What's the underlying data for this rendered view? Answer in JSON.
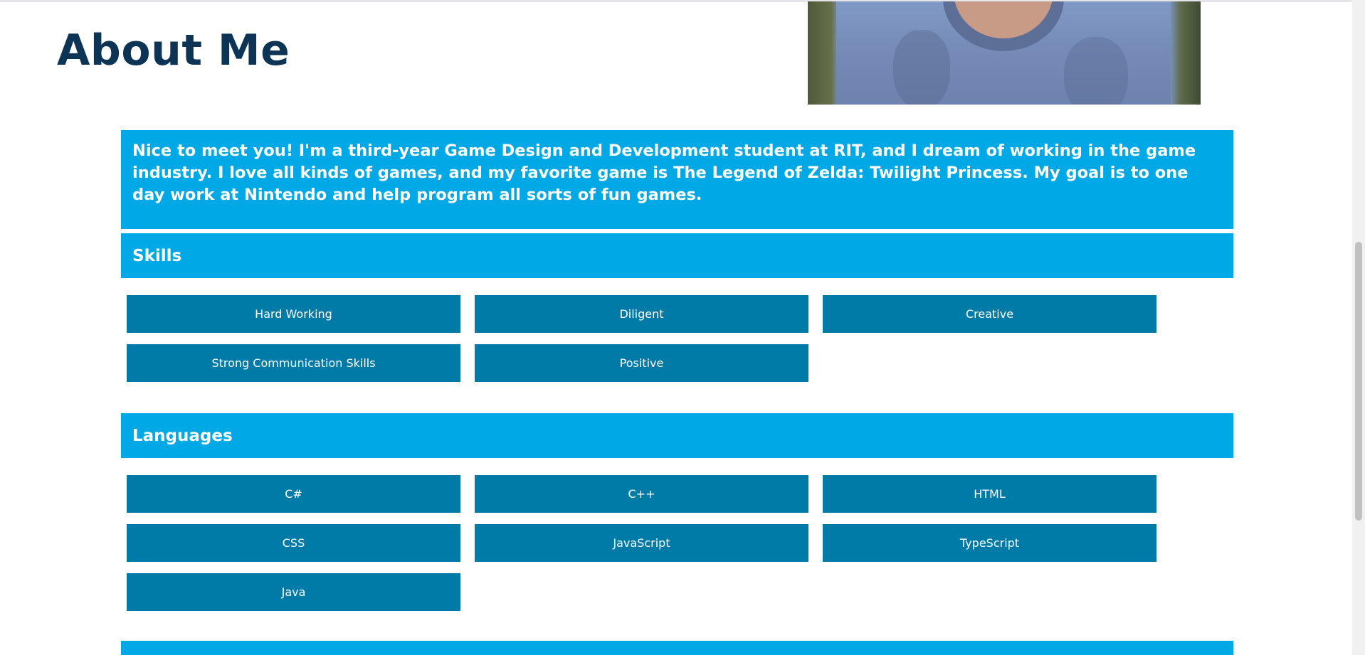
{
  "header": {
    "title": "About Me"
  },
  "intro": {
    "text": "Nice to meet you! I'm a third-year Game Design and Development student at RIT, and I dream of working in the game industry. I love all kinds of games, and my favorite game is The Legend of Zelda: Twilight Princess. My goal is to one day work at Nintendo and help program all sorts of fun games."
  },
  "skills": {
    "heading": "Skills",
    "items": [
      "Hard Working",
      "Diligent",
      "Creative",
      "Strong Communication Skills",
      "Positive"
    ]
  },
  "languages": {
    "heading": "Languages",
    "items": [
      "C#",
      "C++",
      "HTML",
      "CSS",
      "JavaScript",
      "TypeScript",
      "Java"
    ]
  },
  "colors": {
    "band": "#00a8e6",
    "tile": "#007aa6",
    "title": "#0d3454"
  }
}
